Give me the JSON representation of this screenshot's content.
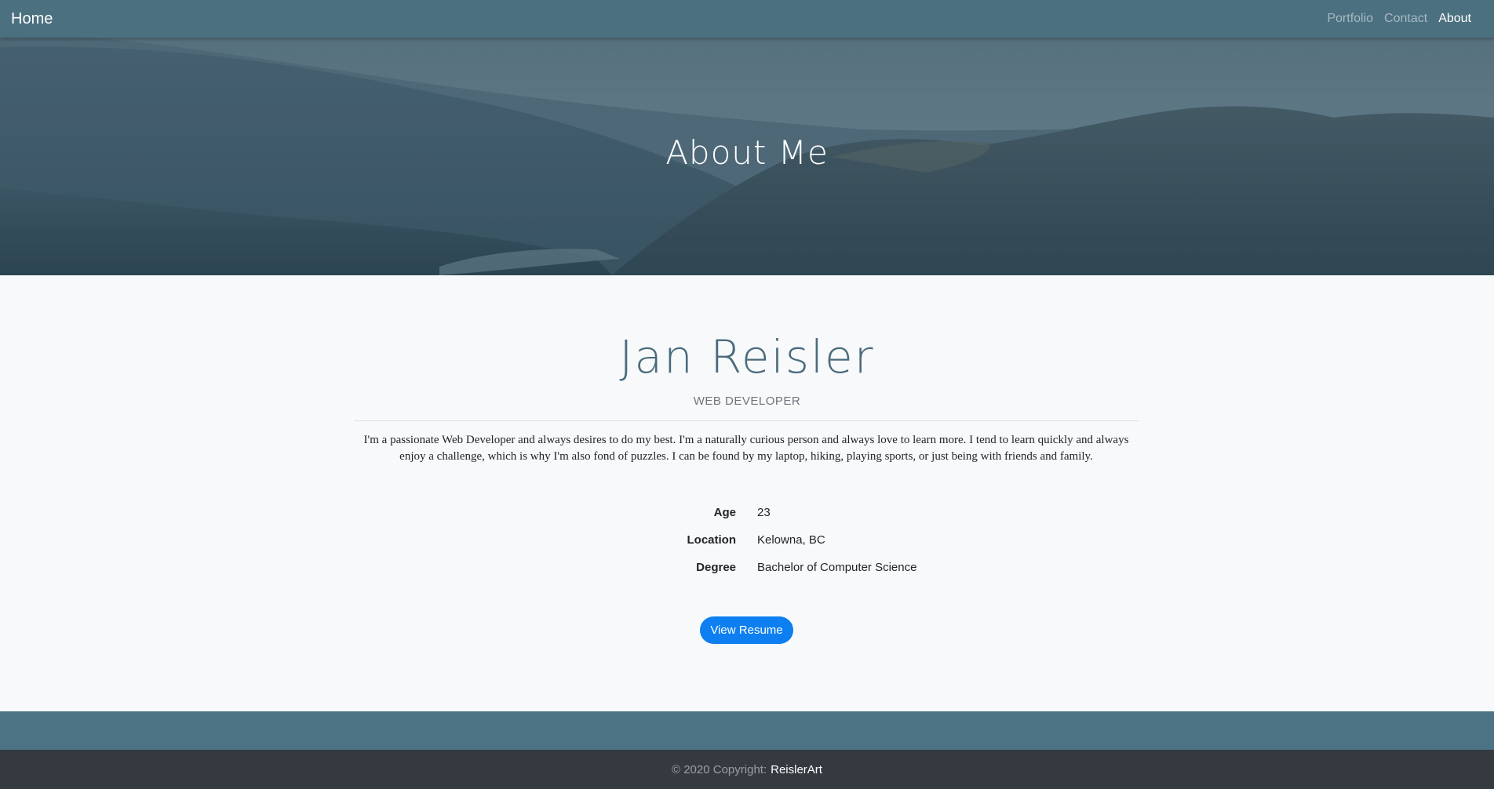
{
  "nav": {
    "brand": "Home",
    "links": [
      {
        "label": "Portfolio"
      },
      {
        "label": "Contact"
      },
      {
        "label": "About"
      }
    ]
  },
  "hero": {
    "title": "About Me"
  },
  "profile": {
    "name": "Jan Reisler",
    "role": "WEB DEVELOPER",
    "bio": "I'm a passionate Web Developer and always desires to do my best. I'm a naturally curious person and always love to learn more. I tend to learn quickly and always enjoy a challenge, which is why I'm also fond of puzzles. I can be found by my laptop, hiking, playing sports, or just being with friends and family.",
    "details": [
      {
        "label": "Age",
        "value": "23"
      },
      {
        "label": "Location",
        "value": "Kelowna, BC"
      },
      {
        "label": "Degree",
        "value": "Bachelor of Computer Science"
      }
    ],
    "resume_label": "View Resume"
  },
  "footer": {
    "copyright": "© 2020 Copyright:",
    "link": "ReislerArt"
  },
  "colors": {
    "navbar": "#4a7080",
    "accent": "#0d7ff0",
    "name": "#4a6b7d",
    "band": "#4c7384",
    "footer": "#343a40"
  }
}
